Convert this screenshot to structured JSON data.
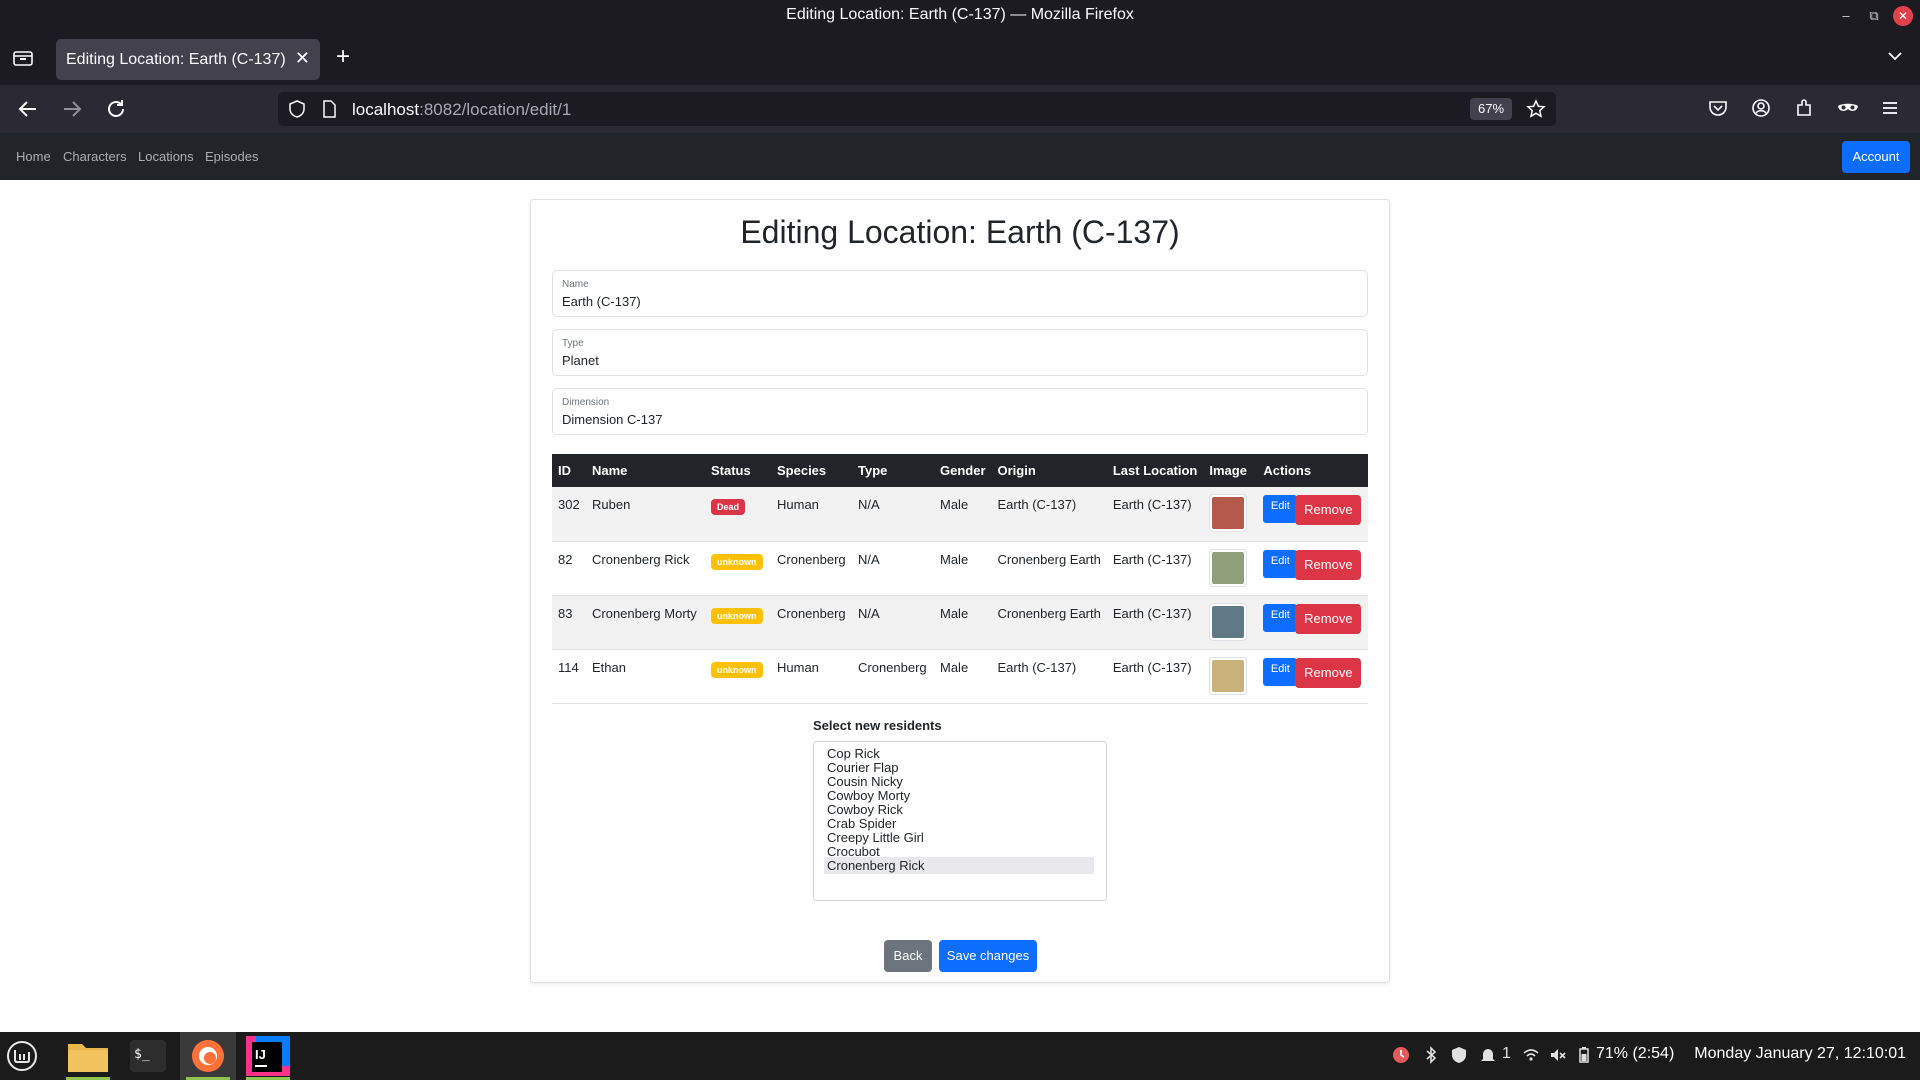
{
  "window": {
    "title": "Editing Location: Earth (C-137) — Mozilla Firefox"
  },
  "browser": {
    "tab_title": "Editing Location: Earth (C-137)",
    "url_host": "localhost",
    "url_rest": ":8082/location/edit/1",
    "zoom": "67%"
  },
  "appnav": {
    "links": [
      "Home",
      "Characters",
      "Locations",
      "Episodes"
    ],
    "account": "Account"
  },
  "page": {
    "heading": "Editing Location: Earth (C-137)",
    "fields": [
      {
        "label": "Name",
        "value": "Earth (C-137)"
      },
      {
        "label": "Type",
        "value": "Planet"
      },
      {
        "label": "Dimension",
        "value": "Dimension C-137"
      }
    ],
    "table": {
      "headers": [
        "ID",
        "Name",
        "Status",
        "Species",
        "Type",
        "Gender",
        "Origin",
        "Last Location",
        "Image",
        "Actions"
      ],
      "rows": [
        {
          "id": "302",
          "name": "Ruben",
          "status": "Dead",
          "species": "Human",
          "type": "N/A",
          "gender": "Male",
          "origin": "Earth (C-137)",
          "last_location": "Earth (C-137)",
          "avatar_color": "#b45a4a"
        },
        {
          "id": "82",
          "name": "Cronenberg Rick",
          "status": "unknown",
          "species": "Cronenberg",
          "type": "N/A",
          "gender": "Male",
          "origin": "Cronenberg Earth",
          "last_location": "Earth (C-137)",
          "avatar_color": "#8fa07a"
        },
        {
          "id": "83",
          "name": "Cronenberg Morty",
          "status": "unknown",
          "species": "Cronenberg",
          "type": "N/A",
          "gender": "Male",
          "origin": "Cronenberg Earth",
          "last_location": "Earth (C-137)",
          "avatar_color": "#5f7a86"
        },
        {
          "id": "114",
          "name": "Ethan",
          "status": "unknown",
          "species": "Human",
          "type": "Cronenberg",
          "gender": "Male",
          "origin": "Earth (C-137)",
          "last_location": "Earth (C-137)",
          "avatar_color": "#c9b37a"
        }
      ],
      "edit_label": "Edit",
      "remove_label": "Remove"
    },
    "residents": {
      "label": "Select new residents",
      "options": [
        "Cop Rick",
        "Courier Flap",
        "Cousin Nicky",
        "Cowboy Morty",
        "Cowboy Rick",
        "Crab Spider",
        "Creepy Little Girl",
        "Crocubot",
        "Cronenberg Rick"
      ],
      "selected": "Cronenberg Rick"
    },
    "back_label": "Back",
    "save_label": "Save changes"
  },
  "taskbar": {
    "notifications": "1",
    "battery": "71% (2:54)",
    "clock": "Monday January 27, 12:10:01"
  },
  "colors": {
    "primary": "#0d6efd",
    "danger": "#dc3545",
    "warning": "#ffc107",
    "secondary": "#6c757d",
    "dark": "#212529"
  }
}
